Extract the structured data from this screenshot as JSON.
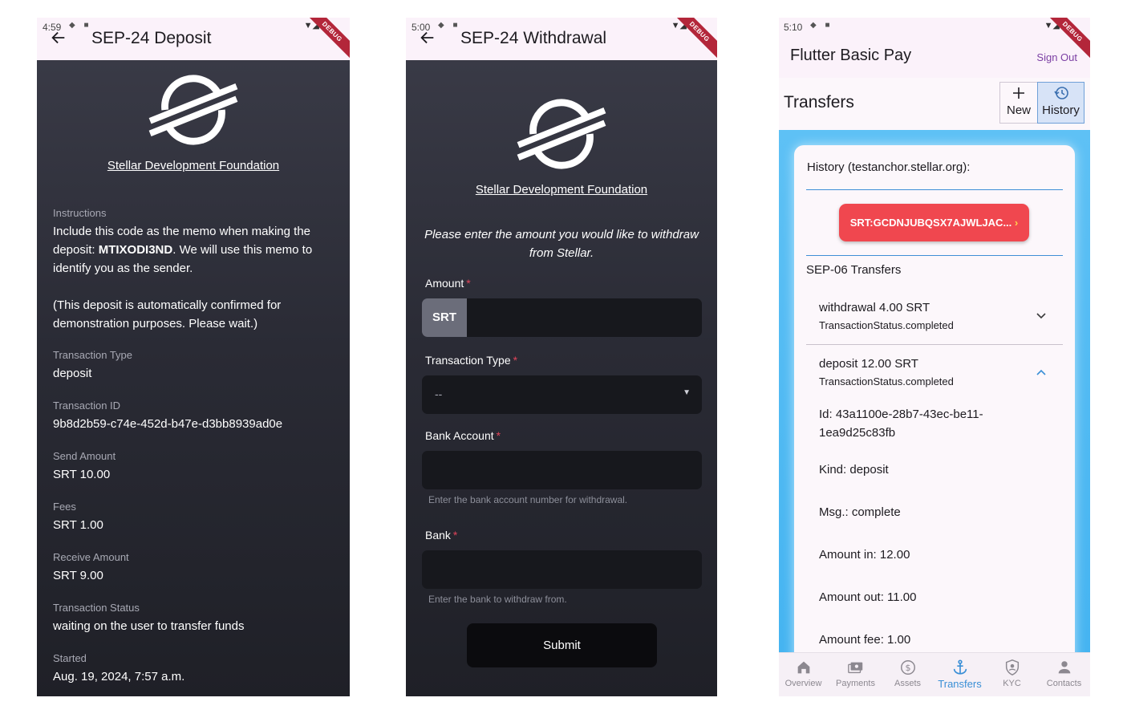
{
  "phone1": {
    "status_time": "4:59",
    "title": "SEP-24 Deposit",
    "debug_label": "DEBUG",
    "org_link": "Stellar Development Foundation",
    "instructions_label": "Instructions",
    "instructions_pre": "Include this code as the memo when making the deposit: ",
    "memo": "MTIXODI3ND",
    "instructions_post": ". We will use this memo to identify you as the sender.",
    "auto_note": "(This deposit is automatically confirmed for demonstration purposes. Please wait.)",
    "fields": [
      {
        "label": "Transaction Type",
        "value": "deposit"
      },
      {
        "label": "Transaction ID",
        "value": "9b8d2b59-c74e-452d-b47e-d3bb8939ad0e"
      },
      {
        "label": "Send Amount",
        "value": "SRT 10.00"
      },
      {
        "label": "Fees",
        "value": "SRT 1.00"
      },
      {
        "label": "Receive Amount",
        "value": "SRT 9.00"
      },
      {
        "label": "Transaction Status",
        "value": "waiting on the user to transfer funds"
      },
      {
        "label": "Started",
        "value": "Aug. 19, 2024, 7:57 a.m."
      }
    ]
  },
  "phone2": {
    "status_time": "5:00",
    "title": "SEP-24 Withdrawal",
    "debug_label": "DEBUG",
    "org_link": "Stellar Development Foundation",
    "note": "Please enter the amount you would like to withdraw from Stellar.",
    "amount_label": "Amount",
    "asset_code": "SRT",
    "amount_value": "",
    "tx_type_label": "Transaction Type",
    "tx_type_value": "--",
    "bank_account_label": "Bank Account",
    "bank_account_value": "",
    "bank_account_hint": "Enter the bank account number for withdrawal.",
    "bank_label": "Bank",
    "bank_value": "",
    "bank_hint": "Enter the bank to withdraw from.",
    "submit_label": "Submit",
    "required_mark": "*"
  },
  "phone3": {
    "status_time": "5:10",
    "debug_label": "DEBUG",
    "app_title": "Flutter Basic Pay",
    "sign_out": "Sign Out",
    "section_title": "Transfers",
    "segments": [
      {
        "label": "New",
        "icon": "plus-icon",
        "selected": false
      },
      {
        "label": "History",
        "icon": "history-icon",
        "selected": true
      }
    ],
    "history_title": "History (testanchor.stellar.org):",
    "asset_pill": "SRT:GCDNJUBQSX7AJWLJAC...",
    "sep06_title": "SEP-06 Transfers",
    "transactions": [
      {
        "title": "withdrawal 4.00 SRT",
        "status": "TransactionStatus.completed",
        "expanded": false
      },
      {
        "title": "deposit 12.00 SRT",
        "status": "TransactionStatus.completed",
        "expanded": true
      }
    ],
    "details": {
      "id": "Id: 43a1100e-28b7-43ec-be11-1ea9d25c83fb",
      "kind": "Kind: deposit",
      "msg": "Msg.: complete",
      "amount_in": "Amount in: 12.00",
      "amount_out": "Amount out: 11.00",
      "amount_fee": "Amount fee: 1.00"
    },
    "nav": [
      {
        "label": "Overview",
        "icon": "home-icon",
        "active": false
      },
      {
        "label": "Payments",
        "icon": "payments-icon",
        "active": false
      },
      {
        "label": "Assets",
        "icon": "assets-icon",
        "active": false
      },
      {
        "label": "Transfers",
        "icon": "anchor-icon",
        "active": true
      },
      {
        "label": "KYC",
        "icon": "kyc-shield-icon",
        "active": false
      },
      {
        "label": "Contacts",
        "icon": "person-icon",
        "active": false
      }
    ],
    "colors": {
      "accent": "#3a8fd6",
      "pill": "#f0474f",
      "selected_segment": "#d7e3f7"
    }
  }
}
